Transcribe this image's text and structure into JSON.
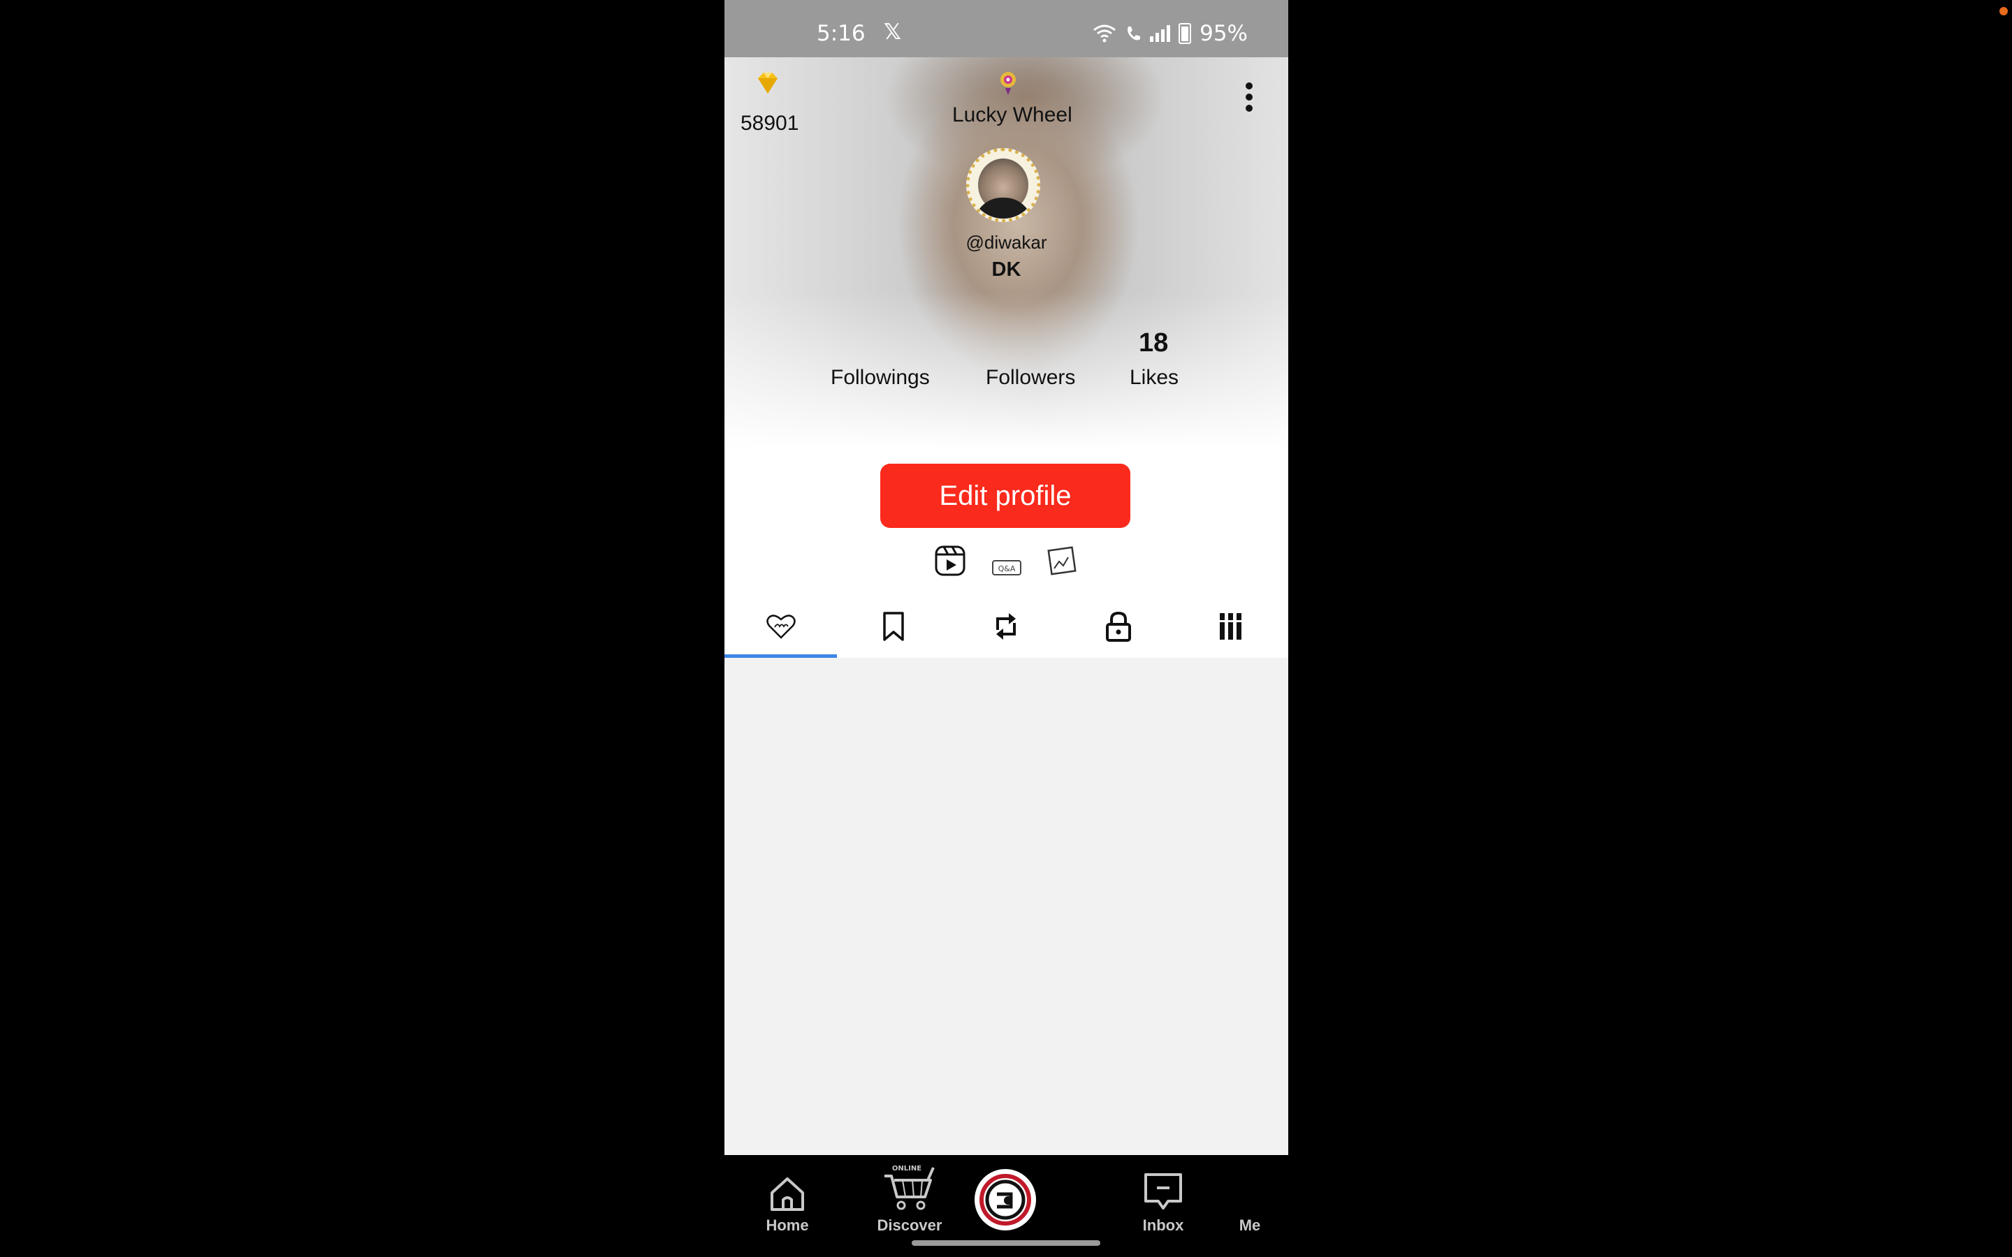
{
  "status_bar": {
    "time": "5:16",
    "notification_app": "𝕏",
    "battery": "95%"
  },
  "header": {
    "coins": "58901",
    "lucky_wheel_label": "Lucky Wheel"
  },
  "profile": {
    "handle": "@diwakar",
    "nickname": "DK"
  },
  "stats": {
    "followings_value": "",
    "followings_label": "Followings",
    "followers_value": "",
    "followers_label": "Followers",
    "likes_value": "18",
    "likes_label": "Likes"
  },
  "actions": {
    "edit_profile_label": "Edit profile"
  },
  "mini_icons": [
    "reels-icon",
    "qa-icon",
    "gallery-icon"
  ],
  "tabs": [
    {
      "icon": "love-heart-icon",
      "selected": true
    },
    {
      "icon": "bookmark-icon",
      "selected": false
    },
    {
      "icon": "repost-icon",
      "selected": false
    },
    {
      "icon": "lock-icon",
      "selected": false
    },
    {
      "icon": "columns-icon",
      "selected": false
    }
  ],
  "bottom_nav": {
    "home_label": "Home",
    "discover_label": "Discover",
    "discover_badge": "ONLINE",
    "inbox_label": "Inbox",
    "me_label": "Me"
  },
  "colors": {
    "accent": "#fa2a1c",
    "tab_indicator": "#3d86e6",
    "avatar_ring": "#d8b14a"
  }
}
